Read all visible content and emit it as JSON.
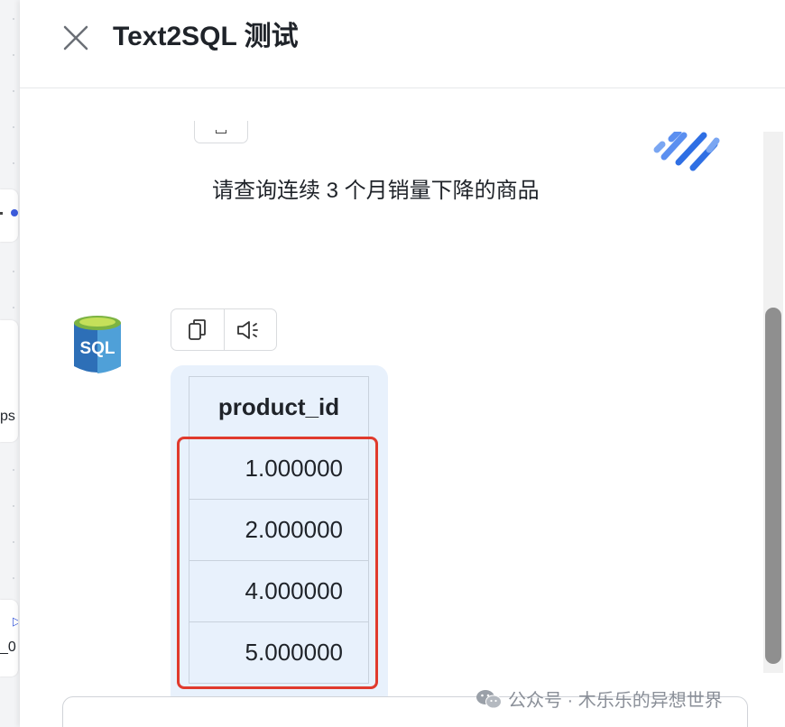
{
  "background": {
    "partial_label_1": "ps",
    "partial_label_2": "_0"
  },
  "drawer": {
    "title": "Text2SQL 测试",
    "close_icon": "close-icon"
  },
  "chat": {
    "user_question": "请查询连续 3 个月销量下降的商品",
    "assistant_avatar_label": "SQL",
    "toolbar": [
      {
        "name": "copy",
        "icon": "copy-icon"
      },
      {
        "name": "speak",
        "icon": "speaker-icon"
      }
    ],
    "result_table": {
      "columns": [
        "product_id"
      ],
      "rows": [
        [
          "1.000000"
        ],
        [
          "2.000000"
        ],
        [
          "4.000000"
        ],
        [
          "5.000000"
        ]
      ]
    }
  },
  "watermark": {
    "text": "公众号 · 木乐乐的异想世界"
  },
  "colors": {
    "highlight": "#e03a2d",
    "bubble": "#e8f1fc",
    "accent_blue": "#2f6fe4"
  }
}
